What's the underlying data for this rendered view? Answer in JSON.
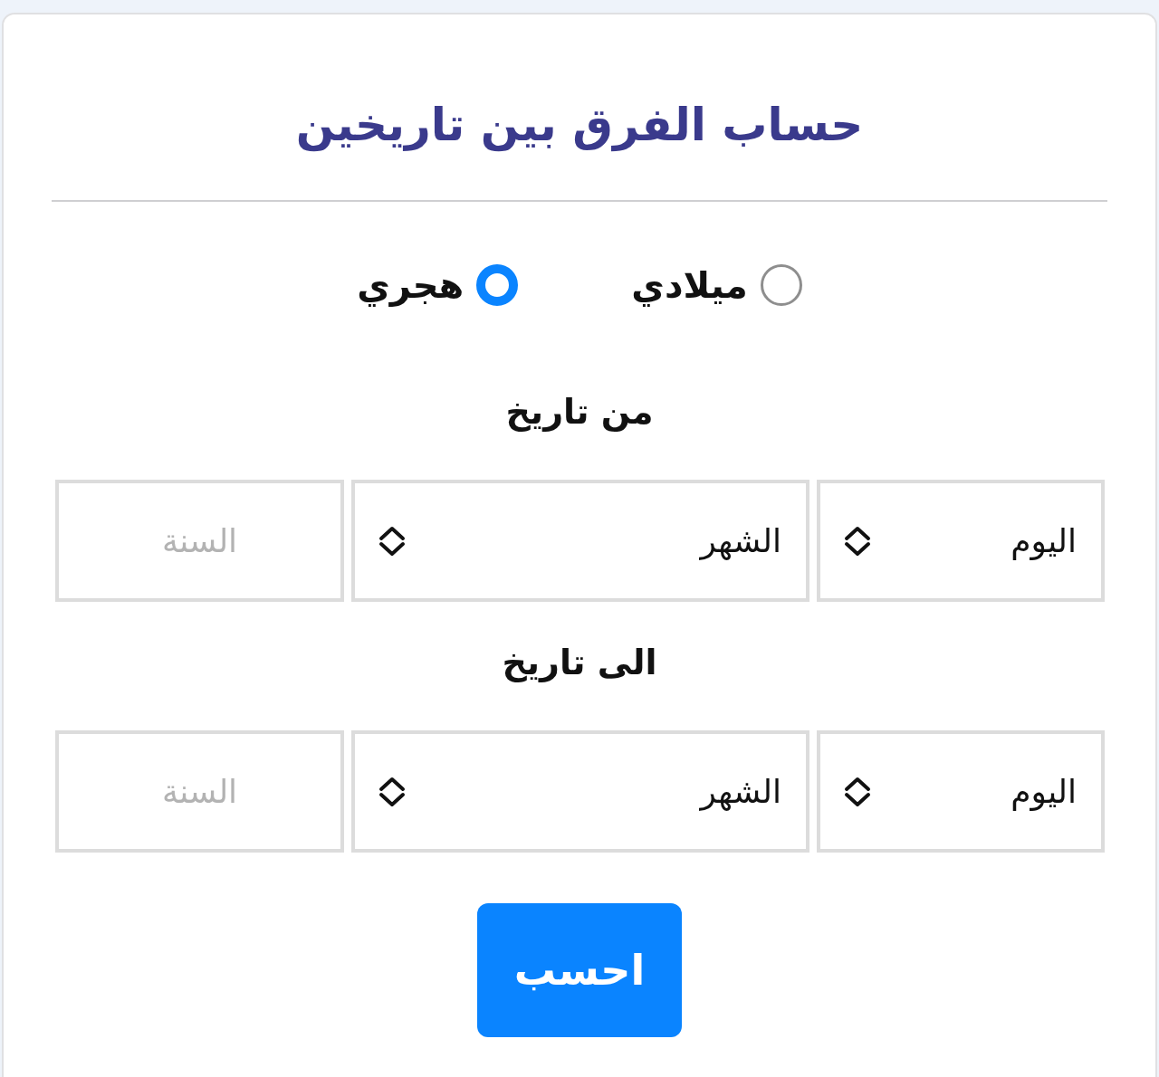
{
  "title": "حساب الفرق بين تاريخين",
  "calendar_options": [
    {
      "label": "ميلادي",
      "selected": false
    },
    {
      "label": "هجري",
      "selected": true
    }
  ],
  "date_groups": [
    {
      "heading": "من تاريخ",
      "fields": [
        {
          "kind": "select",
          "value": "اليوم"
        },
        {
          "kind": "select",
          "value": "الشهر"
        },
        {
          "kind": "input",
          "placeholder": "السنة"
        }
      ]
    },
    {
      "heading": "الى تاريخ",
      "fields": [
        {
          "kind": "select",
          "value": "اليوم"
        },
        {
          "kind": "select",
          "value": "الشهر"
        },
        {
          "kind": "input",
          "placeholder": "السنة"
        }
      ]
    }
  ],
  "calculate_button": "احسب"
}
